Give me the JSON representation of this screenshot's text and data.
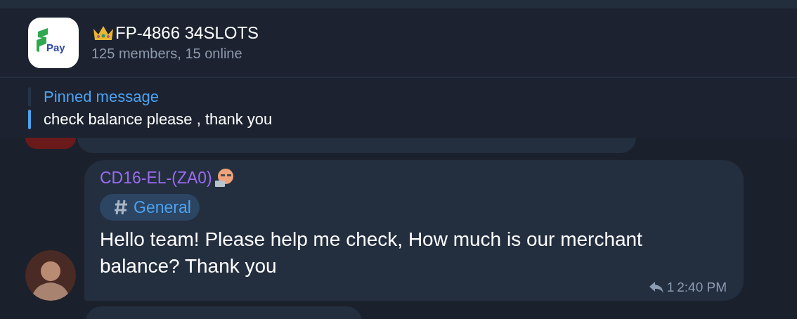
{
  "header": {
    "logo_text": "Pay",
    "title": "FP-4866 34SLOTS",
    "subtitle": "125 members, 15 online"
  },
  "pinned": {
    "label": "Pinned message",
    "text": "check balance please , thank you"
  },
  "message": {
    "sender": "CD16-EL-(ZA0)",
    "topic": "General",
    "text": "Hello team! Please help me check, How much is our merchant balance? Thank you",
    "replies": "1",
    "time": "2:40 PM"
  }
}
